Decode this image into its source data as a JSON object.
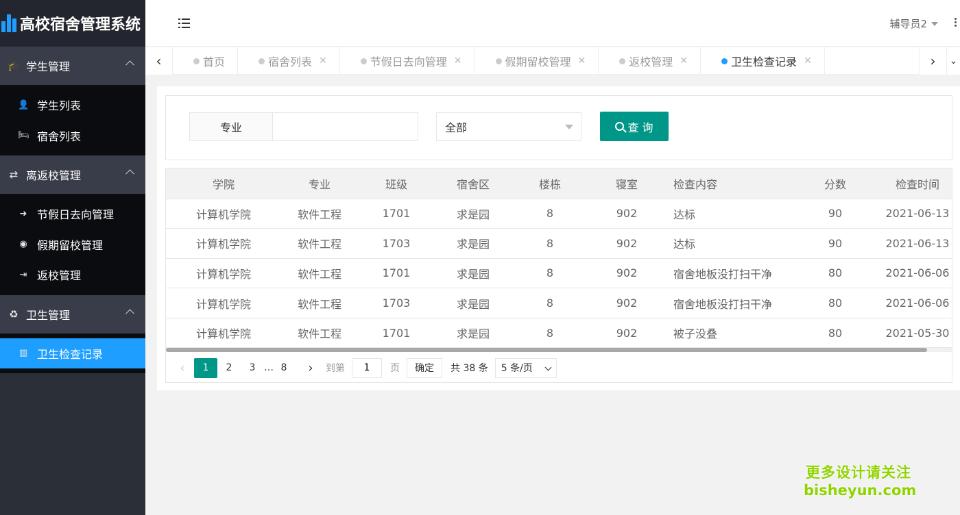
{
  "app": {
    "title": "高校宿舍管理系统"
  },
  "sidebar": {
    "groups": [
      {
        "label": "学生管理",
        "icon": "graduation-cap-icon",
        "items": [
          {
            "label": "学生列表",
            "icon": "user-icon"
          },
          {
            "label": "宿舍列表",
            "icon": "bed-icon"
          }
        ]
      },
      {
        "label": "离返校管理",
        "icon": "exchange-icon",
        "items": [
          {
            "label": "节假日去向管理",
            "icon": "sign-out-icon"
          },
          {
            "label": "假期留校管理",
            "icon": "globe-icon"
          },
          {
            "label": "返校管理",
            "icon": "sign-in-icon"
          }
        ]
      },
      {
        "label": "卫生管理",
        "icon": "recycle-icon",
        "items": [
          {
            "label": "卫生检查记录",
            "icon": "bar-chart-icon",
            "active": true
          }
        ]
      }
    ]
  },
  "header": {
    "user": "辅导员2"
  },
  "tabs": [
    {
      "label": "首页",
      "closable": false
    },
    {
      "label": "宿舍列表",
      "closable": true
    },
    {
      "label": "节假日去向管理",
      "closable": true
    },
    {
      "label": "假期留校管理",
      "closable": true
    },
    {
      "label": "返校管理",
      "closable": true
    },
    {
      "label": "卫生检查记录",
      "closable": true,
      "active": true
    }
  ],
  "search": {
    "field_label": "专业",
    "field_value": "",
    "select_value": "全部",
    "button_label": "查 询"
  },
  "table": {
    "columns": [
      "学院",
      "专业",
      "班级",
      "宿舍区",
      "楼栋",
      "寝室",
      "检查内容",
      "分数",
      "检查时间"
    ],
    "rows": [
      [
        "计算机学院",
        "软件工程",
        "1701",
        "求是园",
        "8",
        "902",
        "达标",
        "90",
        "2021-06-13"
      ],
      [
        "计算机学院",
        "软件工程",
        "1703",
        "求是园",
        "8",
        "902",
        "达标",
        "90",
        "2021-06-13"
      ],
      [
        "计算机学院",
        "软件工程",
        "1701",
        "求是园",
        "8",
        "902",
        "宿舍地板没打扫干净",
        "80",
        "2021-06-06"
      ],
      [
        "计算机学院",
        "软件工程",
        "1703",
        "求是园",
        "8",
        "902",
        "宿舍地板没打扫干净",
        "80",
        "2021-06-06"
      ],
      [
        "计算机学院",
        "软件工程",
        "1701",
        "求是园",
        "8",
        "902",
        "被子没叠",
        "80",
        "2021-05-30"
      ]
    ]
  },
  "pagination": {
    "pages": [
      "1",
      "2",
      "3"
    ],
    "ellipsis": "…",
    "last_page": "8",
    "current": "1",
    "goto_label": "到第",
    "goto_value": "1",
    "page_unit": "页",
    "confirm_label": "确定",
    "total": "共 38 条",
    "page_size": "5 条/页"
  },
  "watermark": {
    "line1": "更多设计请关注",
    "line2": "bisheyun.com"
  },
  "colors": {
    "primary": "#009688",
    "accent": "#1e9fff",
    "sidebar": "#2b2f38"
  }
}
